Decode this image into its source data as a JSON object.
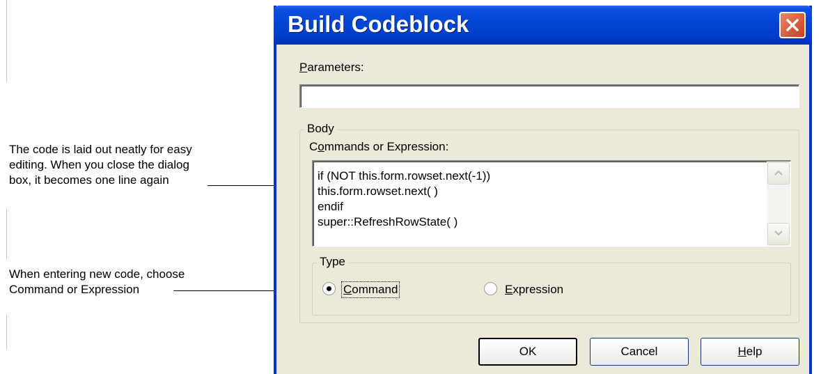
{
  "annotations": {
    "code_note": [
      "The code is laid out neatly for easy",
      "editing. When you close the dialog",
      "box, it becomes one line again"
    ],
    "type_note": [
      "When entering new code, choose",
      "Command or Expression"
    ]
  },
  "dialog": {
    "title": "Build Codeblock",
    "close_icon": "close-icon",
    "parameters_label_accel": "P",
    "parameters_label_rest": "arameters:",
    "parameters_value": "",
    "body_group_label": "Body",
    "commands_label_pre": "C",
    "commands_label_accel": "o",
    "commands_label_rest": "mmands or Expression:",
    "code_lines": [
      "if (NOT this.form.rowset.next(-1))",
      "this.form.rowset.next( )",
      "endif",
      "super::RefreshRowState( )"
    ],
    "type_group_label": "Type",
    "type_options": [
      {
        "accel": "C",
        "rest": "ommand",
        "checked": true
      },
      {
        "accel": "E",
        "rest": "xpression",
        "checked": false
      }
    ],
    "buttons": {
      "ok": "OK",
      "cancel": "Cancel",
      "help_accel": "H",
      "help_rest": "elp"
    }
  },
  "colors": {
    "titlebar": "#0244d1",
    "dialog_bg": "#ece9d8",
    "close_button": "#d9572f"
  }
}
